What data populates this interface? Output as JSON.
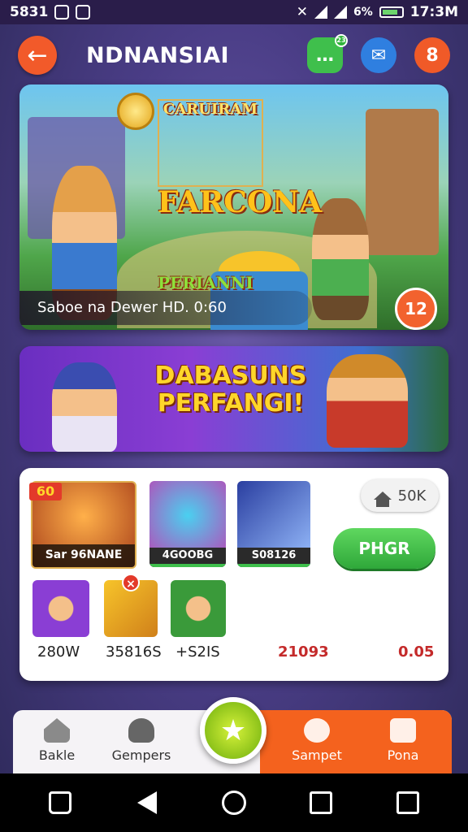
{
  "status_bar": {
    "left_text": "5831",
    "battery": "6%",
    "time": "17:3M"
  },
  "header": {
    "title": "NDNANSIAI",
    "chat_badge": "23",
    "profile_label": "8"
  },
  "hero": {
    "title_line1": "CARUIRAM",
    "title_line2": "FARCONA",
    "title_line3": "PERIANNI",
    "caption": "Saboe na Dewer HD. 0:60",
    "badge": "12"
  },
  "promo": {
    "text_line1": "DABASUNS",
    "text_line2": "PERFANGI!"
  },
  "games": {
    "featured_badge": "60",
    "tiles": [
      {
        "label": "Sar 96NANE"
      },
      {
        "label": "4GOOBG"
      },
      {
        "label": "S08126"
      }
    ],
    "stat": "50K",
    "play_label": "PHGR",
    "values": [
      "280W",
      "35816S",
      "+S2IS",
      "21093",
      "0.05"
    ]
  },
  "tabbar": {
    "home": "Bakle",
    "games": "Gempers",
    "support": "Sampet",
    "promo": "Pona"
  },
  "colors": {
    "accent_orange": "#f4621e",
    "accent_green": "#3fbf4c",
    "background": "#4a3d86"
  }
}
